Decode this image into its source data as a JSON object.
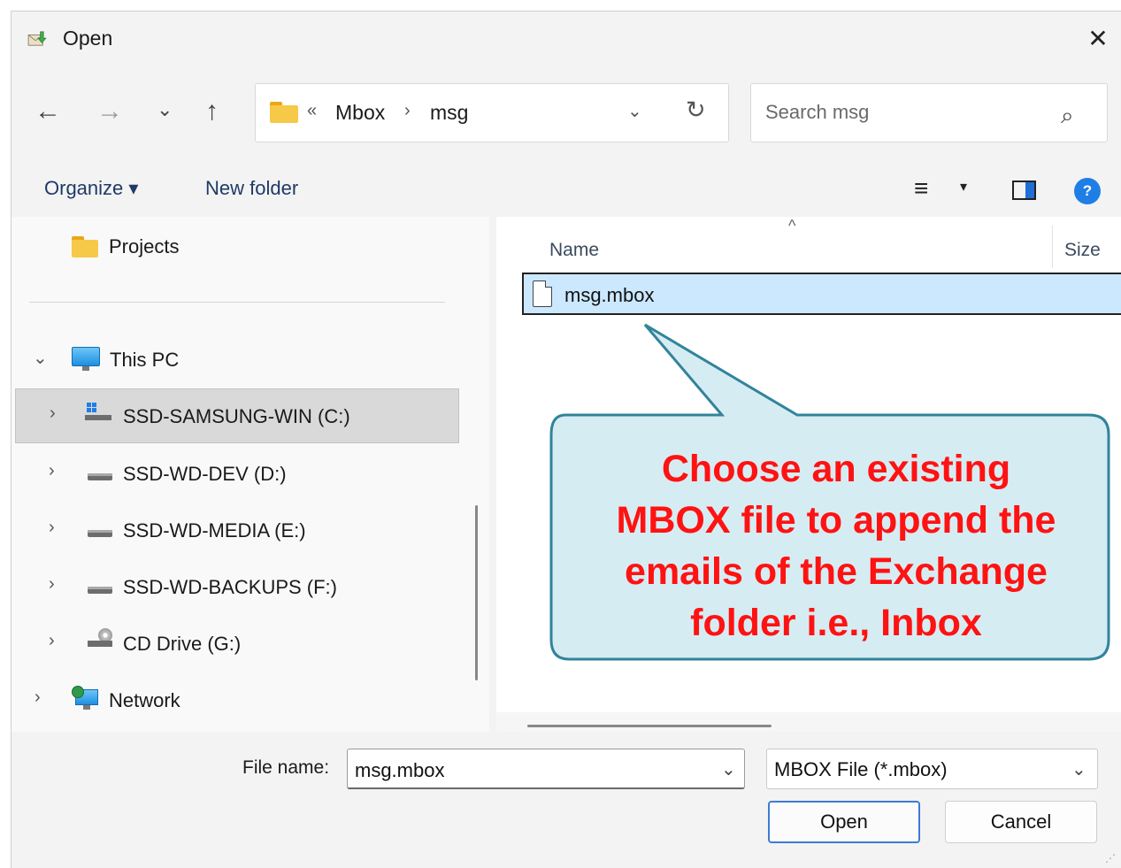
{
  "window": {
    "title": "Open",
    "close_glyph": "✕"
  },
  "nav": {
    "back_glyph": "←",
    "forward_glyph": "→",
    "recent_glyph": "⌄",
    "up_glyph": "↑"
  },
  "address": {
    "overflow_glyph": "«",
    "crumbs": [
      "Mbox",
      "msg"
    ],
    "separator": "›",
    "dropdown_glyph": "⌄",
    "refresh_glyph": "↻"
  },
  "search": {
    "placeholder": "Search msg",
    "icon_glyph": "⌕"
  },
  "toolbar": {
    "organize": "Organize ▾",
    "new_folder": "New folder",
    "view_glyph": "≡",
    "view_caret": "▾",
    "help_glyph": "?"
  },
  "tree": {
    "pinned": {
      "label": "Projects"
    },
    "this_pc": {
      "label": "This PC",
      "chevron": "⌄"
    },
    "drives": [
      {
        "label": "SSD-SAMSUNG-WIN (C:)",
        "chevron": "›"
      },
      {
        "label": "SSD-WD-DEV (D:)",
        "chevron": "›"
      },
      {
        "label": "SSD-WD-MEDIA (E:)",
        "chevron": "›"
      },
      {
        "label": "SSD-WD-BACKUPS (F:)",
        "chevron": "›"
      },
      {
        "label": "CD Drive (G:)",
        "chevron": "›"
      }
    ],
    "network": {
      "label": "Network",
      "chevron": "›"
    }
  },
  "list": {
    "sort_glyph": "^",
    "columns": {
      "name": "Name",
      "size": "Size"
    },
    "files": [
      {
        "name": "msg.mbox"
      }
    ]
  },
  "callout": {
    "lines": [
      "Choose an existing",
      "MBOX file to append the",
      "emails of the Exchange",
      "folder i.e., Inbox"
    ]
  },
  "footer": {
    "file_name_label": "File name:",
    "file_name_value": "msg.mbox",
    "file_name_dropdown": "⌄",
    "filter": "MBOX File (*.mbox)",
    "filter_dropdown": "⌄",
    "open_label": "Open",
    "cancel_label": "Cancel",
    "grip_glyph": "⋰"
  },
  "colors": {
    "accent": "#3d7bd4",
    "selection": "#cce8ff",
    "callout_fill": "#d6ecf3",
    "callout_border": "#31849b",
    "callout_text": "#ff1212"
  }
}
